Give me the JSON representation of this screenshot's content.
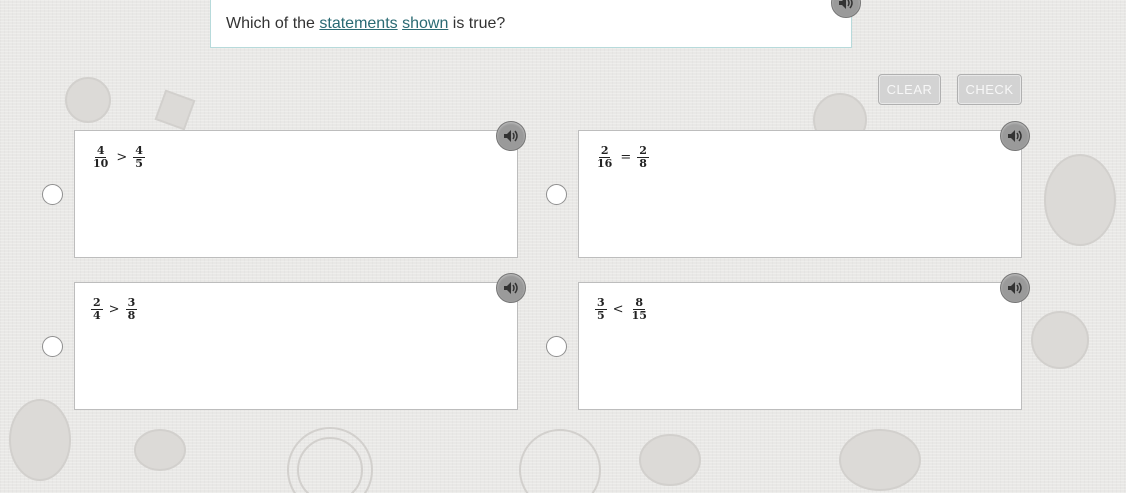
{
  "question": {
    "prefix": "Which of the ",
    "link1": "statements",
    "space": " ",
    "link2": "shown",
    "suffix": " is true?"
  },
  "buttons": {
    "clear_label": "CLEAR",
    "check_label": "CHECK"
  },
  "options": [
    {
      "left_num": "4",
      "left_den": "10",
      "op": ">",
      "right_num": "4",
      "right_den": "5"
    },
    {
      "left_num": "2",
      "left_den": "16",
      "op": "=",
      "right_num": "2",
      "right_den": "8"
    },
    {
      "left_num": "2",
      "left_den": "4",
      "op": ">",
      "right_num": "3",
      "right_den": "8"
    },
    {
      "left_num": "3",
      "left_den": "5",
      "op": "<",
      "right_num": "8",
      "right_den": "15"
    }
  ],
  "colors": {
    "link": "#2a6a73",
    "question_border": "#b7dadb",
    "button_bg": "#d3d3d3",
    "audio_bg": "#9a9a9a"
  },
  "icons": {
    "audio": "speaker-icon"
  }
}
